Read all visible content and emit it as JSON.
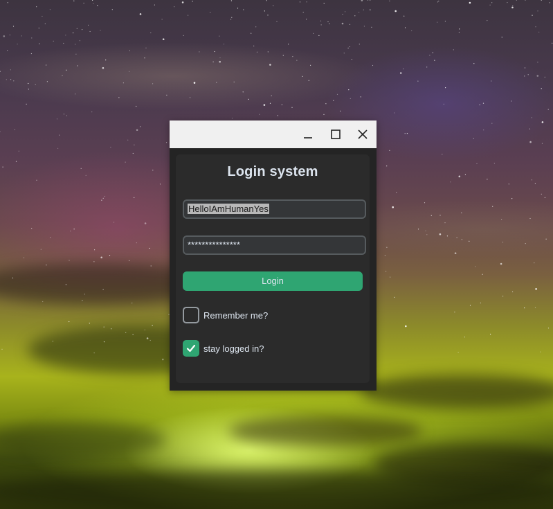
{
  "window": {
    "minimize_icon": "minimize-icon",
    "maximize_icon": "maximize-icon",
    "close_icon": "close-icon"
  },
  "form": {
    "title": "Login system",
    "username_value": "HelloIAmHumanYes",
    "password_value": "***************",
    "login_label": "Login",
    "remember_label": "Remember me?",
    "remember_checked": false,
    "stay_label": "stay logged in?",
    "stay_checked": true
  },
  "colors": {
    "accent": "#2fa572",
    "panel": "#2b2b2b",
    "window_bg": "#242424",
    "titlebar": "#f0f0f0",
    "text": "#dce4ee"
  }
}
